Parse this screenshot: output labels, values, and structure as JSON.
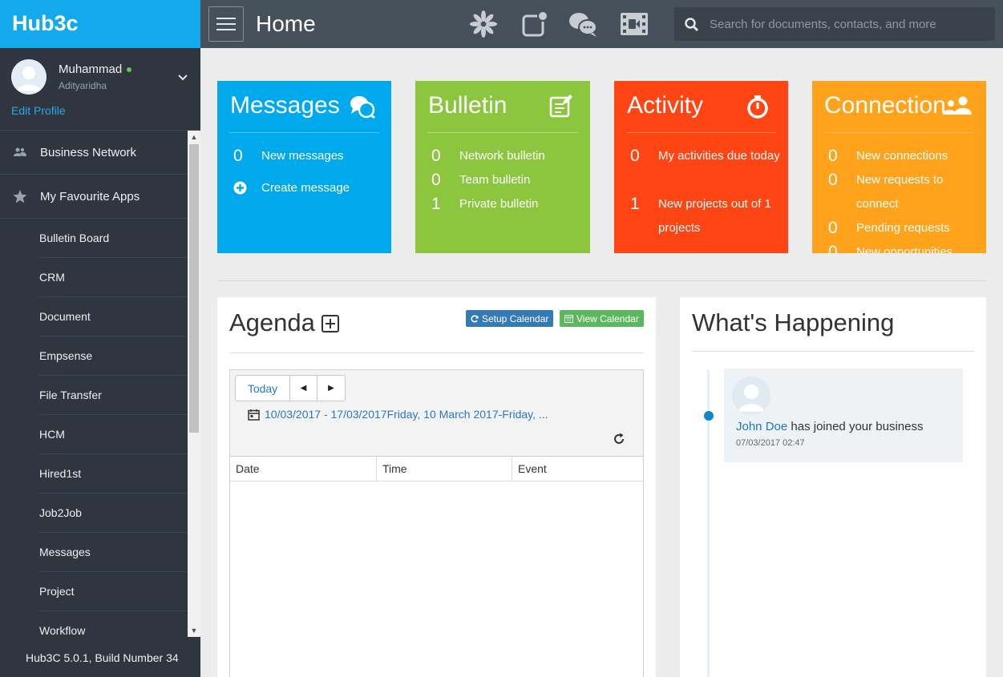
{
  "brand": "Hub3c",
  "profile": {
    "name": "Muhammad",
    "subtitle": "Adityaridha",
    "edit_link": "Edit Profile"
  },
  "menu": {
    "top": [
      {
        "label": "Business Network",
        "icon": "users-icon"
      },
      {
        "label": "My Favourite Apps",
        "icon": "star-icon"
      }
    ],
    "apps": [
      "Bulletin Board",
      "CRM",
      "Document",
      "Empsense",
      "File Transfer",
      "HCM",
      "Hired1st",
      "Job2Job",
      "Messages",
      "Project",
      "Workflow"
    ]
  },
  "build": "Hub3C 5.0.1, Build Number 34",
  "header": {
    "title": "Home",
    "icons": [
      "apps-pinwheel-icon",
      "notification-icon",
      "chat-icon",
      "video-icon"
    ],
    "search_placeholder": "Search for documents, contacts, and more"
  },
  "tiles": [
    {
      "title": "Messages",
      "icon": "messages-icon",
      "color": "#00a9ec",
      "rows": [
        {
          "num": "0",
          "label": "New messages"
        },
        {
          "num": "",
          "label": "Create message",
          "icon": "plus-circle-icon"
        }
      ]
    },
    {
      "title": "Bulletin",
      "icon": "bulletin-icon",
      "color": "#8cc63f",
      "rows": [
        {
          "num": "0",
          "label": "Network bulletin"
        },
        {
          "num": "0",
          "label": "Team bulletin"
        },
        {
          "num": "1",
          "label": "Private bulletin"
        }
      ]
    },
    {
      "title": "Activity",
      "icon": "stopwatch-icon",
      "color": "#ff4514",
      "rows": [
        {
          "num": "0",
          "label": "My activities due today"
        },
        {
          "num": "1",
          "label": "New projects out of 1 projects"
        }
      ]
    },
    {
      "title": "Connection",
      "icon": "people-icon",
      "color": "#fea31b",
      "rows": [
        {
          "num": "0",
          "label": "New connections"
        },
        {
          "num": "0",
          "label": "New requests to connect"
        },
        {
          "num": "0",
          "label": "Pending requests"
        },
        {
          "num": "0",
          "label": "New opportunities"
        }
      ]
    }
  ],
  "agenda": {
    "title": "Agenda",
    "setup_button": "Setup Calendar",
    "view_button": "View Calendar",
    "today_button": "Today",
    "range": "10/03/2017 - 17/03/2017Friday, 10 March 2017-Friday, ...",
    "columns": [
      "Date",
      "Time",
      "Event"
    ]
  },
  "happening": {
    "title": "What's Happening",
    "items": [
      {
        "user": "John Doe",
        "text": "has joined your business",
        "time": "07/03/2017 02:47"
      }
    ]
  }
}
